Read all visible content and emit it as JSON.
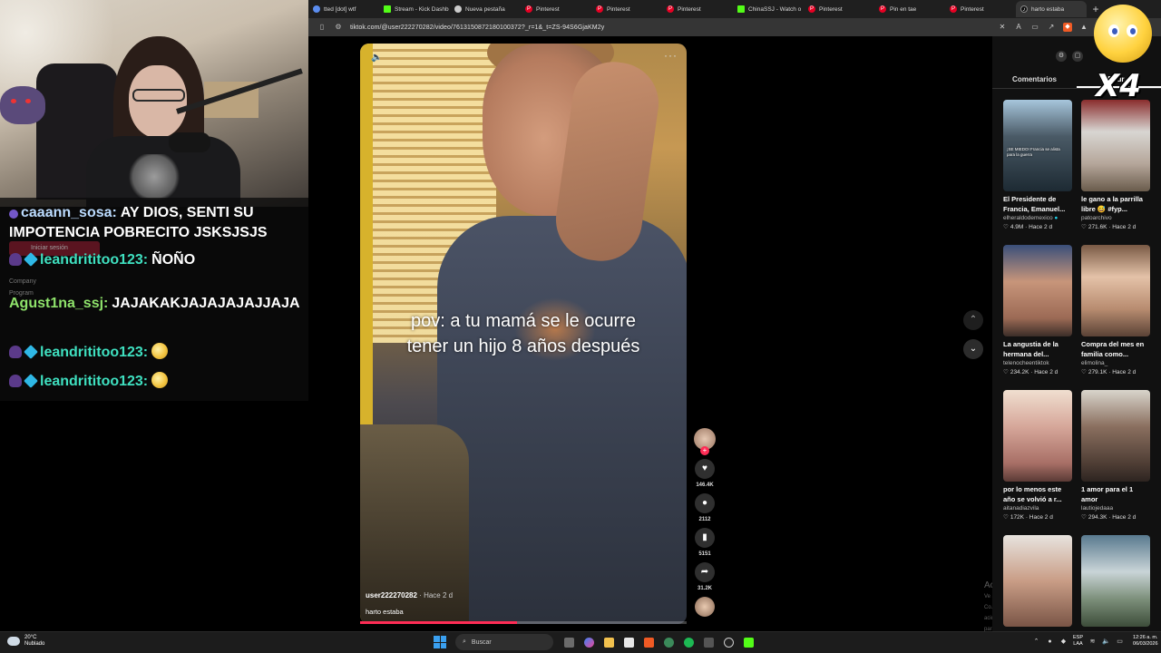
{
  "browser": {
    "tabs": [
      {
        "label": "tted [dot] wtf",
        "icon": "generic-icon",
        "active": false
      },
      {
        "label": "Stream - Kick Dashb",
        "icon": "kick-icon",
        "active": false
      },
      {
        "label": "Nueva pestaña",
        "icon": "github-icon",
        "active": false
      },
      {
        "label": "Pinterest",
        "icon": "pinterest-icon",
        "active": false
      },
      {
        "label": "Pinterest",
        "icon": "pinterest-icon",
        "active": false
      },
      {
        "label": "Pinterest",
        "icon": "pinterest-icon",
        "active": false
      },
      {
        "label": "ChinaSSJ - Watch o",
        "icon": "kick-icon",
        "active": false
      },
      {
        "label": "Pinterest",
        "icon": "pinterest-icon",
        "active": false
      },
      {
        "label": "Pin en tae",
        "icon": "pinterest-icon",
        "active": false
      },
      {
        "label": "Pinterest",
        "icon": "pinterest-icon",
        "active": false
      },
      {
        "label": "harto estaba",
        "icon": "tiktok-icon",
        "active": true
      }
    ],
    "new_tab": "+",
    "url": "tiktok.com/@user222270282/video/7613150872180100372?_r=1&_t=ZS-94S6GjaKM2y"
  },
  "chat": {
    "ghost": {
      "login": "Iniciar sesión",
      "company": "Company",
      "program": "Program"
    },
    "messages": [
      {
        "user": "caaann_sosa:",
        "text": "AY DIOS, SENTI SU IMPOTENCIA POBRECITO JSKSJSJS",
        "color": "#bcdcff",
        "badges": [
          "dot"
        ],
        "emote": false
      },
      {
        "user": "leandrititoo123:",
        "text": "ÑOÑO",
        "color": "#3fe0c0",
        "badges": [
          "demon",
          "cube"
        ],
        "emote": false
      },
      {
        "user": "Agust1na_ssj:",
        "text": "JAJAKAKJAJAJAJAJJAJA",
        "color": "#8fe36b",
        "badges": [],
        "emote": false
      },
      {
        "user": "leandrititoo123:",
        "text": "",
        "color": "#3fe0c0",
        "badges": [
          "demon",
          "cube"
        ],
        "emote": true
      },
      {
        "user": "leandrititoo123:",
        "text": "",
        "color": "#3fe0c0",
        "badges": [
          "demon",
          "cube"
        ],
        "emote": true
      }
    ]
  },
  "video": {
    "caption_line1": "pov: a tu mamá se le ocurre",
    "caption_line2": "tener un hijo 8 años después",
    "author": "user222270282",
    "when": "· Hace 2 d",
    "description": "harto estaba",
    "progress": 0.48,
    "actions": {
      "likes": "146.4K",
      "comments": "2112",
      "saves": "5151",
      "shares": "31.2K"
    }
  },
  "watermark": {
    "line1": "Activ",
    "line2": "Ve a Co... ación para activar Windows."
  },
  "panel": {
    "tabs": [
      "Comentarios",
      "Podr..."
    ],
    "cards": [
      {
        "title": "El Presidente de Francia, Emanuel...",
        "author": "elheraldodemexico",
        "verified": true,
        "likes": "4.9M",
        "when": "Hace 2 d",
        "overlay": "¡SE MIEDO! Francia se alista para la guerra",
        "thumb": "t1"
      },
      {
        "title": "le gano a la parrilla libre 😅 #fyp...",
        "author": "patoarchivo",
        "verified": false,
        "likes": "271.6K",
        "when": "Hace 2 d",
        "overlay": "",
        "thumb": "t2"
      },
      {
        "title": "La angustia de la hermana del...",
        "author": "telenocheentiktok",
        "verified": false,
        "likes": "234.2K",
        "when": "Hace 2 d",
        "overlay": "",
        "thumb": "t3"
      },
      {
        "title": "Compra del mes en familia como...",
        "author": "elimolina_",
        "verified": false,
        "likes": "279.1K",
        "when": "Hace 2 d",
        "overlay": "",
        "thumb": "t4"
      },
      {
        "title": "por lo menos este año se volvió a r...",
        "author": "aitanadiazvila",
        "verified": false,
        "likes": "172K",
        "when": "Hace 2 d",
        "overlay": "",
        "thumb": "t5"
      },
      {
        "title": "1 amor para el 1 amor",
        "author": "lautiojedaaa",
        "verified": false,
        "likes": "294.3K",
        "when": "Hace 2 d",
        "overlay": "",
        "thumb": "t6"
      },
      {
        "title": "",
        "author": "",
        "verified": false,
        "likes": "",
        "when": "",
        "overlay": "",
        "thumb": "t7"
      },
      {
        "title": "",
        "author": "",
        "verified": false,
        "likes": "",
        "when": "",
        "overlay": "",
        "thumb": "t8"
      }
    ]
  },
  "overlay": {
    "multiplier": "X4"
  },
  "taskbar": {
    "temperature": "20°C",
    "weather": "Nublado",
    "search": "Buscar",
    "lang1": "ESP",
    "lang2": "LAA",
    "time": "12:26 a. m.",
    "date": "06/03/2026"
  }
}
